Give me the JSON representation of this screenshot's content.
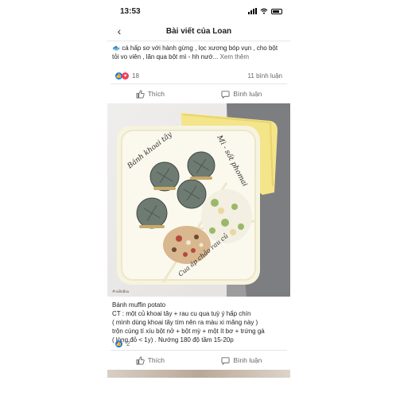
{
  "status": {
    "time": "13:53"
  },
  "header": {
    "title": "Bài viết của Loan"
  },
  "post1": {
    "text": "cá hấp sơ với hành gừng , lọc xương bóp vụn , cho bột tỏi vo viên , lăn qua  bột mì - hh  nướ...",
    "more": "Xem thêm",
    "reaction_count": "18",
    "comments": "11 bình luận",
    "like_label": "Thích",
    "comment_label": "Bình luận"
  },
  "photo": {
    "label_left": "Bánh khoai tây",
    "label_right": "Mì - sốt phomai",
    "label_bottom": "Cua áp chảo rau củ",
    "watermark": "#nuBaBau"
  },
  "post2": {
    "title": "Bánh muffin potato",
    "line1": "CT : một củ khoai tây + rau cu qua tuỳ ý hấp chín",
    "line2": "( mình dùng khoai tây tím nên ra màu xi măng này )",
    "line3": "trộn cùng tí xíu bột nở + bột mỳ + một ít bơ + trứng gà",
    "line4": "( lòng đỏ < 1y) . Nướng 180 độ tầm 15-20p",
    "reaction_count": "2",
    "like_label": "Thích",
    "comment_label": "Bình luận"
  },
  "icons": [
    "back-chevron-icon",
    "like-icon",
    "comment-icon",
    "wifi-icon",
    "battery-icon",
    "signal-icon",
    "fish-emoji-icon"
  ]
}
